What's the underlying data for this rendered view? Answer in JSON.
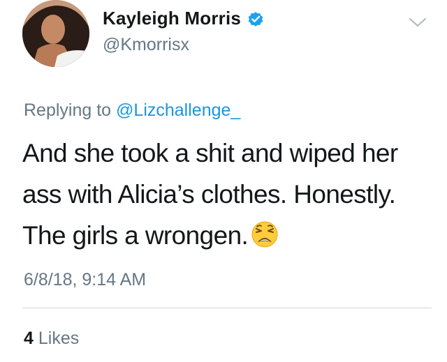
{
  "tweet": {
    "author": {
      "display_name": "Kayleigh Morris",
      "handle": "@Kmorrisx",
      "verified": true,
      "avatar_icon": "profile-photo"
    },
    "reply": {
      "prefix": "Replying to ",
      "mention": "@Lizchallenge_"
    },
    "text": "And she took a shit and wiped her ass with Alicia’s clothes. Honestly. The girls a wrongen.",
    "emoji": "weary-face",
    "timestamp": "6/8/18, 9:14 AM",
    "stats": {
      "likes_count": "4",
      "likes_label": "Likes"
    }
  },
  "colors": {
    "primary_text": "#14171a",
    "secondary_text": "#657786",
    "link": "#1b95e0",
    "verified_badge": "#1da1f2",
    "divider": "#d3d7db"
  },
  "icons": {
    "more_menu": "chevron-down-icon",
    "verified": "verified-badge-icon"
  }
}
